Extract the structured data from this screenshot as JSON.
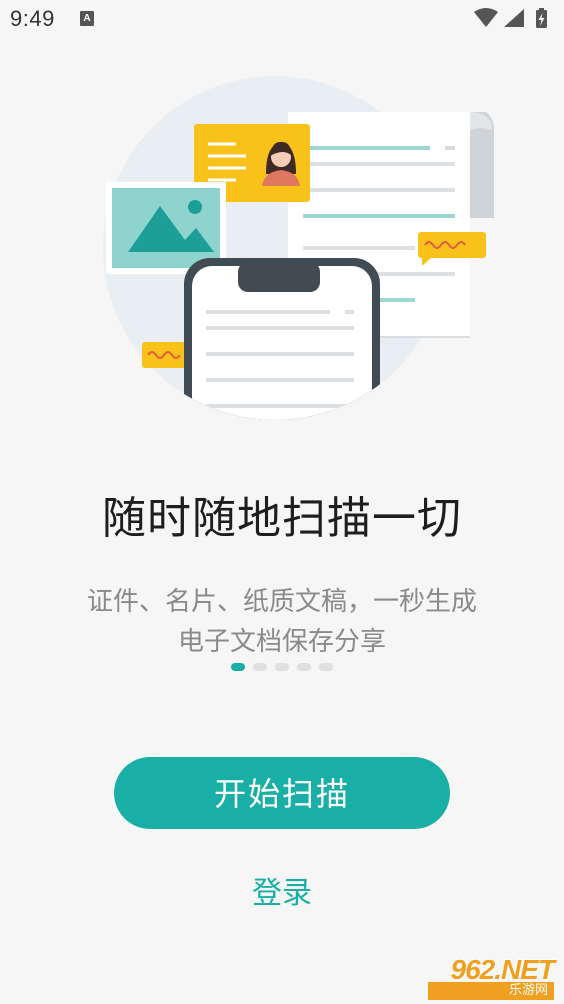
{
  "status_bar": {
    "time": "9:49",
    "notification_icon": "A",
    "icons": [
      "wifi-icon",
      "signal-icon",
      "battery-charging-icon"
    ]
  },
  "onboarding": {
    "title": "随时随地扫描一切",
    "subtitle_line1": "证件、名片、纸质文稿，一秒生成",
    "subtitle_line2": "电子文档保存分享",
    "page_indicator": {
      "total": 5,
      "active": 1
    },
    "primary_button": "开始扫描",
    "login_link": "登录"
  },
  "watermark": {
    "main": "962.NET",
    "sub": "乐游网"
  },
  "colors": {
    "accent": "#1aafa6",
    "background": "#f6f6f6",
    "title": "#1e1e1e",
    "subtitle": "#8a8a8a",
    "yellow": "#f8c21b",
    "photo_teal": "#8fd3cf"
  }
}
